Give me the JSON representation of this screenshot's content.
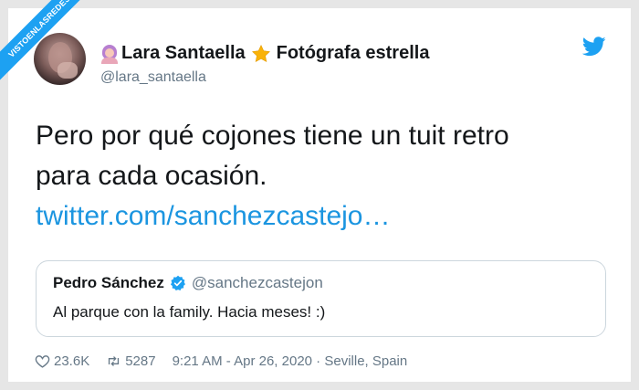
{
  "watermark": {
    "text": "VISTOENLASREDES"
  },
  "author": {
    "name": "Lara Santaella",
    "title_suffix": "Fotógrafa estrella",
    "handle": "@lara_santaella"
  },
  "tweet": {
    "text_line1": "Pero por qué cojones tiene un tuit retro",
    "text_line2": "para cada ocasión.",
    "link": "twitter.com/sanchezcastejo…"
  },
  "quoted": {
    "name": "Pedro Sánchez",
    "handle": "@sanchezcastejon",
    "text": "Al parque con la family. Hacia meses! :)"
  },
  "footer": {
    "likes": "23.6K",
    "retweets": "5287",
    "timestamp": "9:21 AM - Apr 26, 2020 · Seville, Spain"
  },
  "colors": {
    "accent": "#1da1f2",
    "link": "#1b95e0",
    "muted": "#657786",
    "verified": "#1da1f2",
    "star": "#f9b208"
  },
  "icons": [
    "woman-artist-emoji-icon",
    "star-icon",
    "twitter-bird-icon",
    "verified-badge-icon",
    "heart-icon",
    "retweet-icon"
  ]
}
